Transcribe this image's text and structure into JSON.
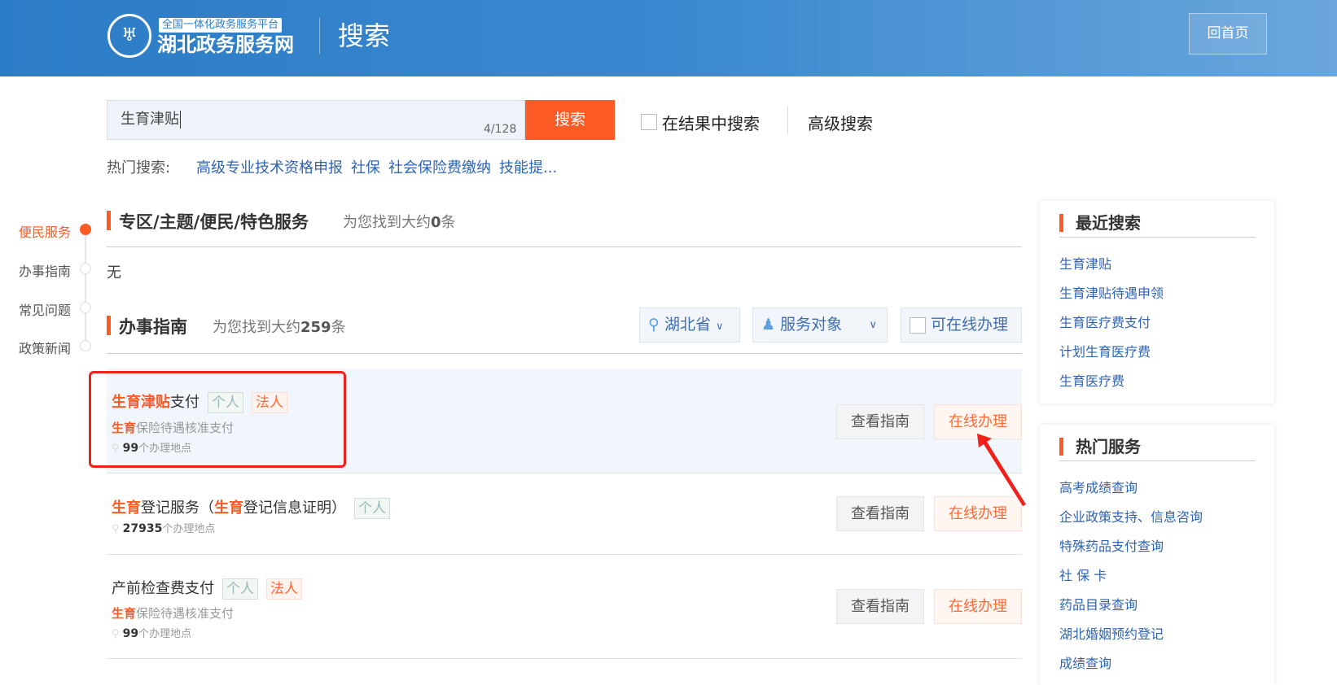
{
  "header": {
    "platform_tag": "全国一体化政务服务平台",
    "site_name": "湖北政务服务网",
    "page_title": "搜索",
    "home_button": "回首页"
  },
  "search": {
    "value": "生育津贴",
    "counter": "4/128",
    "button": "搜索",
    "in_results_label": "在结果中搜索",
    "advanced_label": "高级搜索"
  },
  "hot_search": {
    "label": "热门搜索:",
    "items": [
      "高级专业技术资格申报",
      "社保",
      "社会保险费缴纳",
      "技能提..."
    ]
  },
  "side_nav": [
    "便民服务",
    "办事指南",
    "常见问题",
    "政策新闻"
  ],
  "section1": {
    "title": "专区/主题/便民/特色服务",
    "count_prefix": "为您找到大约",
    "count": "0",
    "count_suffix": "条",
    "empty": "无"
  },
  "section2": {
    "title": "办事指南",
    "count_prefix": "为您找到大约",
    "count": "259",
    "count_suffix": "条",
    "filters": {
      "region": "湖北省",
      "target": "服务对象",
      "online": "可在线办理"
    }
  },
  "results": [
    {
      "title_hl": "生育津贴",
      "title_rest": "支付",
      "badges": [
        "个人",
        "法人"
      ],
      "sub_hl": "生育",
      "sub_rest": "保险待遇核准支付",
      "locations": "99",
      "loc_suffix": "个办理地点"
    },
    {
      "title_hl": "生育",
      "title_rest": "登记服务（",
      "title_hl2": "生育",
      "title_rest2": "登记信息证明）",
      "badges": [
        "个人"
      ],
      "locations": "27935",
      "loc_suffix": "个办理地点"
    },
    {
      "title_rest": "产前检查费支付",
      "badges": [
        "个人",
        "法人"
      ],
      "sub_hl": "生育",
      "sub_rest": "保险待遇核准支付",
      "locations": "99",
      "loc_suffix": "个办理地点"
    }
  ],
  "buttons": {
    "guide": "查看指南",
    "online": "在线办理"
  },
  "recent": {
    "title": "最近搜索",
    "items": [
      "生育津贴",
      "生育津贴待遇申领",
      "生育医疗费支付",
      "计划生育医疗费",
      "生育医疗费"
    ]
  },
  "hot_services": {
    "title": "热门服务",
    "items": [
      "高考成绩查询",
      "企业政策支持、信息咨询",
      "特殊药品支付查询",
      "社 保 卡",
      "药品目录查询",
      "湖北婚姻预约登记",
      "成绩查询"
    ]
  },
  "colors": {
    "accent": "#fd5b25",
    "link": "#2e64b0",
    "header": "#2b7cc6",
    "annotation": "#f0201a"
  }
}
